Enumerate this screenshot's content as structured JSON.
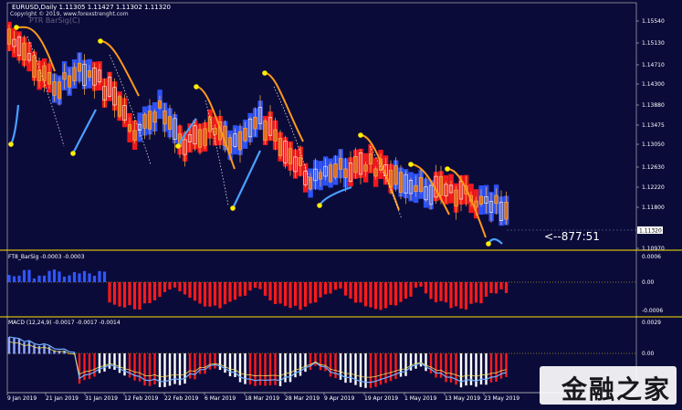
{
  "window": {
    "symbol_header": "EURUSD,Daily  1.11305 1.11427 1.11302 1.11320",
    "copyright": "Copyright © 2019, www.forexstrenght.com",
    "indicator_overlay": "PTR BarSig(C)",
    "countdown": "<--877:51",
    "current_price_label": "1.11320"
  },
  "price_axis": [
    "1.15540",
    "1.15130",
    "1.14710",
    "1.14300",
    "1.13880",
    "1.13475",
    "1.13050",
    "1.12630",
    "1.12220",
    "1.11800",
    "1.10970"
  ],
  "subpanel1": {
    "title": "FT8_BarSig -0.0003 -0.0003",
    "ticks": [
      "0.0006",
      "0.00",
      "-0.0006"
    ]
  },
  "subpanel2": {
    "title": "MACD (12,24,9) -0.0017 -0.0017 -0.0014",
    "ticks": [
      "0.0029",
      "0.00"
    ]
  },
  "time_axis": [
    "9 Jan 2019",
    "21 Jan 2019",
    "31 Jan 2019",
    "12 Feb 2019",
    "22 Feb 2019",
    "6 Mar 2019",
    "18 Mar 2019",
    "28 Mar 2019",
    "9 Apr 2019",
    "19 Apr 2019",
    "1 May 2019",
    "13 May 2019",
    "23 May 2019"
  ],
  "watermark": "金融之家",
  "colors": {
    "background": "#0b0b3a",
    "bull": "#2f56ff",
    "bear": "#ff1a1a",
    "trail_orange": "#ff9a1a",
    "trail_blue": "#4aa0ff",
    "separator": "#ffe600",
    "dot": "#ffee00"
  },
  "icons": [
    "signal-dot-icon"
  ]
}
